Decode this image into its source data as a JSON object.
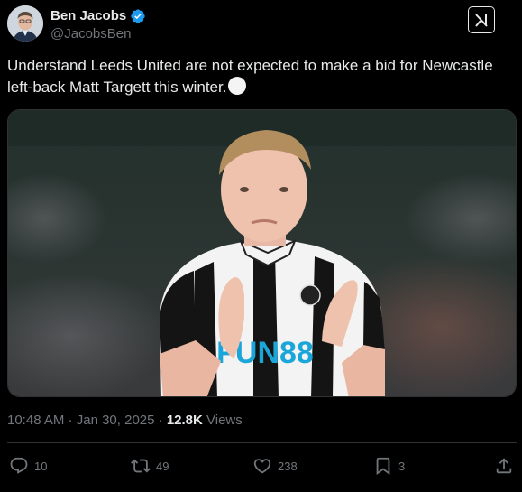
{
  "author": {
    "display_name": "Ben Jacobs",
    "handle": "@JacobsBen",
    "verified_icon": "verified-badge-icon"
  },
  "tweet": {
    "text": "Understand Leeds United are not expected to make a bid for Newcastle left-back Matt Targett this winter."
  },
  "media": {
    "shirt_sponsor": "FUN88",
    "icon": "photo"
  },
  "meta": {
    "time": "10:48 AM",
    "separator": " · ",
    "date": "Jan 30, 2025",
    "views_count": "12.8K",
    "views_label": " Views"
  },
  "actions": {
    "replies": "10",
    "reposts": "49",
    "likes": "238",
    "bookmarks": "3"
  },
  "colors": {
    "background": "#000000",
    "text_primary": "#e7e9ea",
    "text_secondary": "#71767b",
    "verified_blue": "#1d9bf0",
    "divider": "#2f3336"
  }
}
